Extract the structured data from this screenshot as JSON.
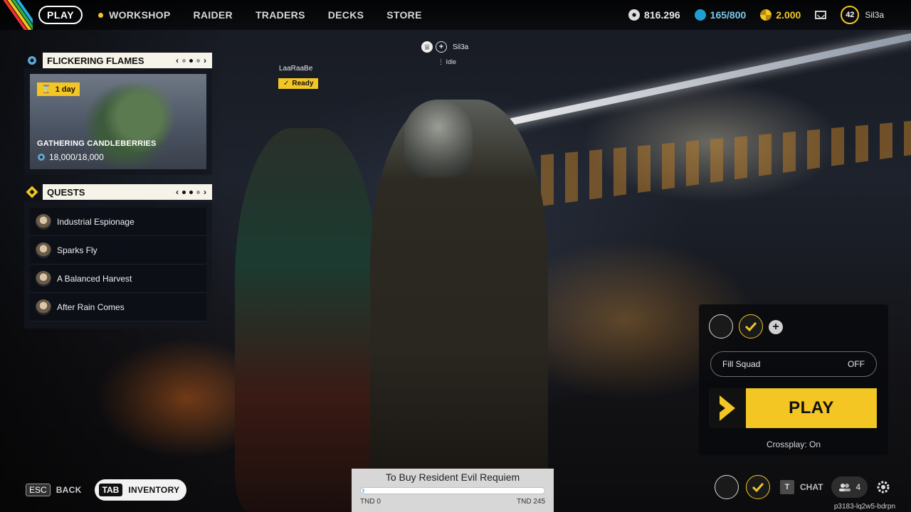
{
  "nav": {
    "play": "PLAY",
    "items": [
      "WORKSHOP",
      "RAIDER",
      "TRADERS",
      "DECKS",
      "STORE"
    ]
  },
  "currencies": {
    "coins": "816.296",
    "blue": "165/800",
    "gold": "2.000"
  },
  "player": {
    "level": "42",
    "name": "Sil3a"
  },
  "event": {
    "title": "FLICKERING FLAMES",
    "badge": "1 day",
    "name": "GATHERING CANDLEBERRIES",
    "progress": "18,000/18,000"
  },
  "quests": {
    "title": "QUESTS",
    "items": [
      "Industrial Espionage",
      "Sparks Fly",
      "A Balanced Harvest",
      "After Rain Comes"
    ]
  },
  "party": {
    "member1": "LaaRaaBe",
    "member1_status": "Ready",
    "host": "Sil3a",
    "host_status": "Idle"
  },
  "play_panel": {
    "fill_squad": "Fill Squad",
    "fill_value": "OFF",
    "play": "PLAY",
    "crossplay": "Crossplay: On"
  },
  "bottom": {
    "esc_key": "ESC",
    "back": "BACK",
    "tab_key": "TAB",
    "inventory": "INVENTORY",
    "t_key": "T",
    "chat": "CHAT",
    "friends_count": "4",
    "build": "p3183-lq2w5-bdrpn"
  },
  "goal": {
    "title": "To Buy Resident Evil Requiem",
    "min_label": "TND 0",
    "max_label": "TND 245",
    "progress_fraction": 0.01
  },
  "colors": {
    "accent": "#f3c623"
  }
}
